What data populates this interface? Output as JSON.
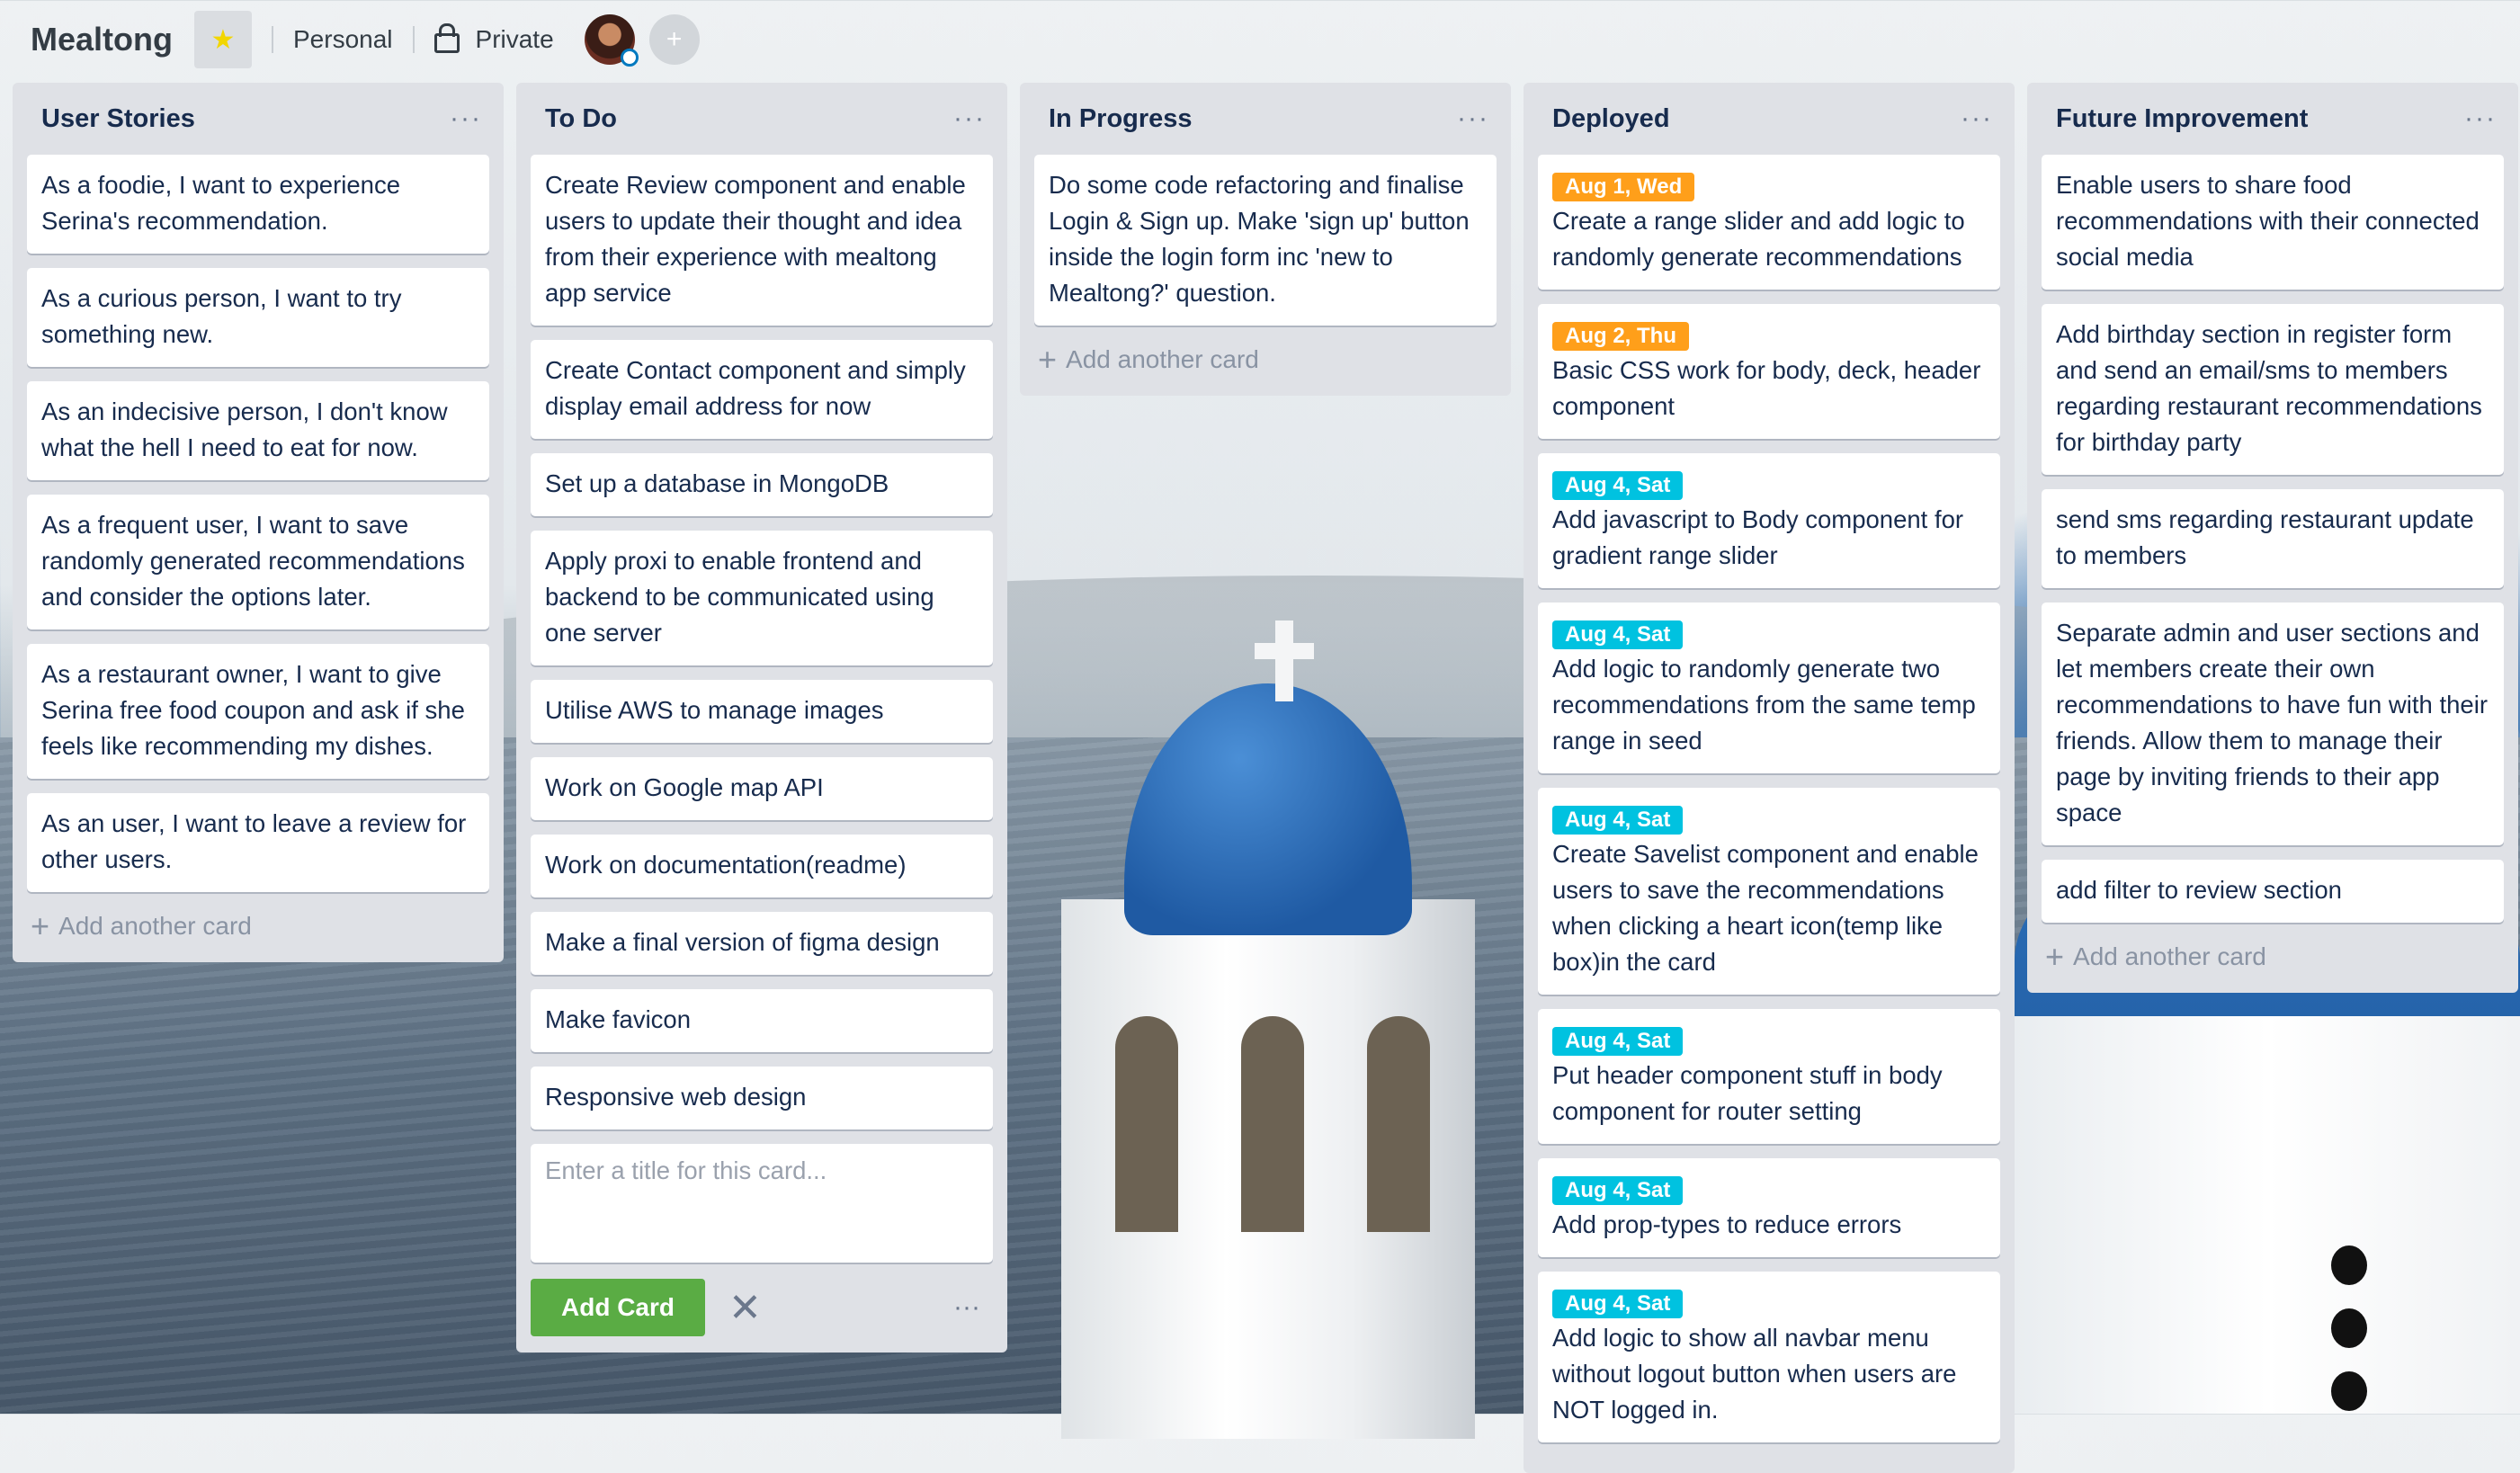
{
  "board": {
    "title": "Mealtong",
    "team": "Personal",
    "visibility": "Private",
    "star_icon": "★"
  },
  "colors": {
    "orange_badge": "#ff9f1a",
    "teal_badge": "#00c2e0",
    "add_button": "#5aac44"
  },
  "add_another_card": "Add another card",
  "lists": [
    {
      "title": "User Stories",
      "cards": [
        "As a foodie, I want to experience Serina's recommendation.",
        "As a curious person, I want to try something new.",
        "As an indecisive person, I don't know what the hell I need to eat for now.",
        "As a frequent user, I want to save randomly generated recommendations and consider the options later.",
        "As a restaurant owner, I want to give Serina free food coupon and ask if she feels like recommending my dishes.",
        "As an user, I want to leave a review for other users."
      ]
    },
    {
      "title": "To Do",
      "cards": [
        "Create Review component and enable users to update their thought and idea from their experience with mealtong app service",
        "Create Contact component and simply display email address for now",
        "Set up a database in MongoDB",
        "Apply proxi to enable frontend and backend to be communicated using one server",
        "Utilise AWS to manage images",
        "Work on Google map API",
        "Work on documentation(readme)",
        "Make a final version of figma design",
        "Make favicon",
        "Responsive web design"
      ],
      "composer_placeholder": "Enter a title for this card...",
      "add_button": "Add Card"
    },
    {
      "title": "In Progress",
      "cards": [
        "Do some code refactoring and finalise Login & Sign up. Make 'sign up' button inside the login form inc 'new to Mealtong?' question."
      ]
    },
    {
      "title": "Deployed",
      "cards": [
        {
          "due": "Aug 1, Wed",
          "due_color": "orange",
          "text": "Create a range slider and add logic to randomly generate recommendations"
        },
        {
          "due": "Aug 2, Thu",
          "due_color": "orange",
          "text": "Basic CSS work for body, deck, header component"
        },
        {
          "due": "Aug 4, Sat",
          "due_color": "teal",
          "text": "Add javascript to Body component for gradient range slider"
        },
        {
          "due": "Aug 4, Sat",
          "due_color": "teal",
          "text": "Add logic to randomly generate two recommendations from the same temp range in seed"
        },
        {
          "due": "Aug 4, Sat",
          "due_color": "teal",
          "text": "Create Savelist component and enable users to save the recommendations when clicking a heart icon(temp like box)in the card"
        },
        {
          "due": "Aug 4, Sat",
          "due_color": "teal",
          "text": "Put header component stuff in body component for router setting"
        },
        {
          "due": "Aug 4, Sat",
          "due_color": "teal",
          "text": "Add prop-types to reduce errors"
        },
        {
          "due": "Aug 4, Sat",
          "due_color": "teal",
          "text": "Add logic to show all navbar menu without logout button when users are NOT logged in."
        }
      ]
    },
    {
      "title": "Future Improvement",
      "cards": [
        "Enable users to share food recommendations with their connected social media",
        "Add birthday section in register form and send an email/sms to members regarding restaurant recommendations for birthday party",
        "send sms regarding restaurant update to members",
        "Separate admin and user sections and let members create their own recommendations to have fun with their friends. Allow them to manage their page by inviting friends to their app space",
        "add filter to review section"
      ]
    }
  ]
}
